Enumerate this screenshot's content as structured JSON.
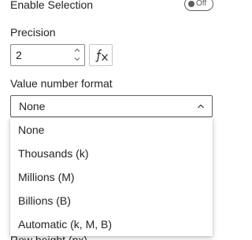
{
  "enable_selection": {
    "label": "Enable Selection",
    "toggle_text": "Off"
  },
  "precision": {
    "label": "Precision",
    "value": "2",
    "fx_icon": "fx-icon"
  },
  "value_number_format": {
    "label": "Value number format",
    "selected": "None",
    "options": [
      "None",
      "Thousands (k)",
      "Millions (M)",
      "Billions (B)",
      "Automatic (k, M, B)"
    ]
  },
  "next_section": {
    "label": "Row height (px)"
  }
}
